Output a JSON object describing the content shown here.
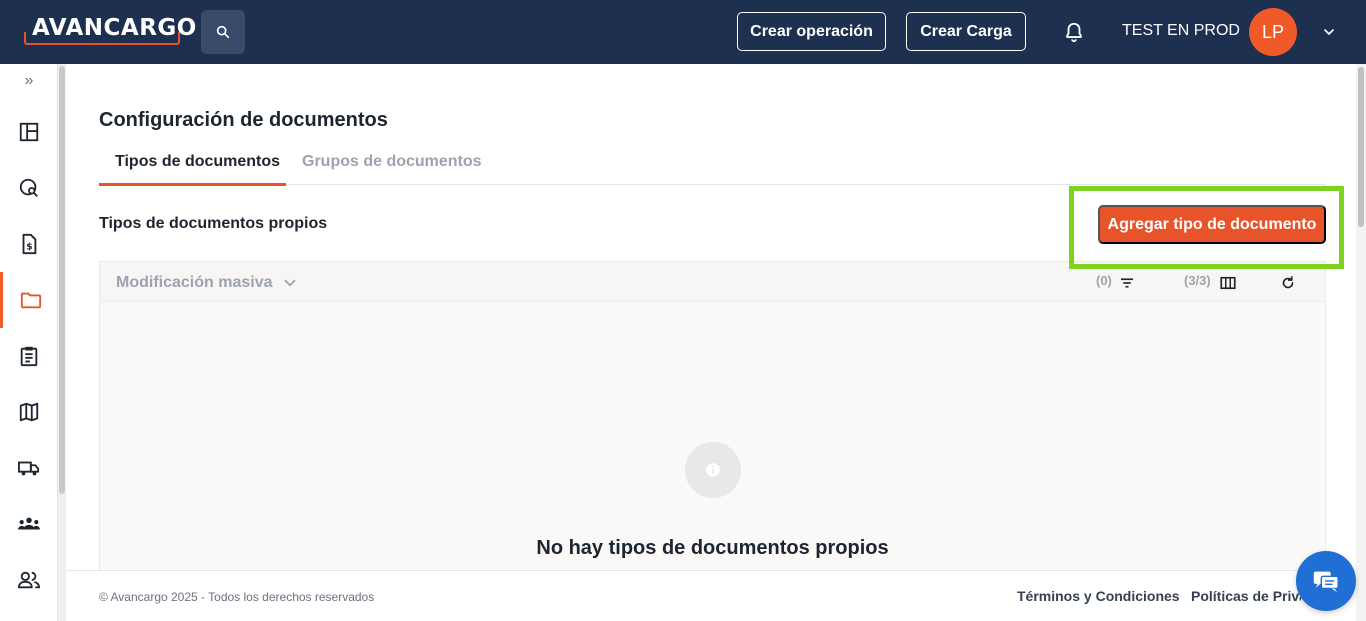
{
  "header": {
    "logo_text": "AVANCARGO",
    "create_operation_label": "Crear operación",
    "create_load_label": "Crear Carga",
    "user_name": "TEST EN PROD",
    "avatar_initials": "LP"
  },
  "sidebar": {
    "items": [
      {
        "icon": "dashboard-icon"
      },
      {
        "icon": "globe-search-icon"
      },
      {
        "icon": "invoice-icon"
      },
      {
        "icon": "folder-icon",
        "active": true
      },
      {
        "icon": "clipboard-icon"
      },
      {
        "icon": "map-icon"
      },
      {
        "icon": "truck-icon"
      },
      {
        "icon": "group-icon"
      },
      {
        "icon": "users-icon"
      }
    ]
  },
  "page": {
    "title": "Configuración de documentos",
    "tabs": [
      {
        "label": "Tipos de documentos",
        "active": true
      },
      {
        "label": "Grupos de documentos",
        "active": false
      }
    ],
    "section_title": "Tipos de documentos propios",
    "add_button_label": "Agregar tipo de documento",
    "table": {
      "bulk_label": "Modificación masiva",
      "filter_count": "(0)",
      "columns_count": "(3/3)",
      "empty_message": "No hay tipos de documentos propios"
    }
  },
  "footer": {
    "copyright": "© Avancargo 2025 - Todos los derechos reservados",
    "terms": "Términos y Condiciones",
    "privacy": "Políticas de Privacidad"
  },
  "colors": {
    "navbar": "#1e3050",
    "accent": "#e8542a",
    "highlight": "#7ed321",
    "chat": "#1f6fd4"
  }
}
